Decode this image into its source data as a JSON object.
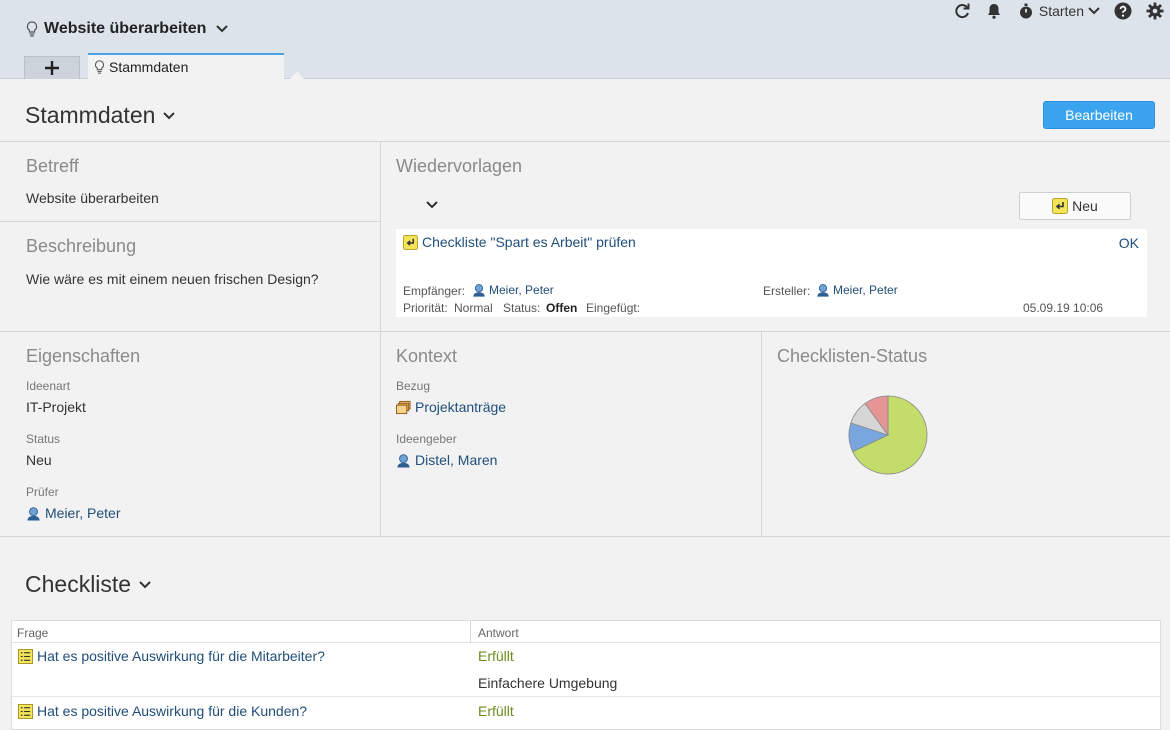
{
  "header": {
    "title": "Website überarbeiten",
    "starten_label": "Starten",
    "tab_label": "Stammdaten"
  },
  "stammdaten": {
    "title": "Stammdaten",
    "edit_label": "Bearbeiten"
  },
  "betreff": {
    "title": "Betreff",
    "value": "Website überarbeiten"
  },
  "beschreibung": {
    "title": "Beschreibung",
    "value": "Wie wäre es mit einem neuen frischen Design?"
  },
  "wiedervorlagen": {
    "title": "Wiedervorlagen",
    "new_label": "Neu",
    "item": {
      "task": "Checkliste \"Spart es Arbeit\" prüfen",
      "action": "OK",
      "recipient_label": "Empfänger:",
      "recipient": "Meier, Peter",
      "creator_label": "Ersteller:",
      "creator": "Meier, Peter",
      "priority_label": "Priorität:",
      "priority": "Normal",
      "status_label": "Status:",
      "status": "Offen",
      "inserted_label": "Eingefügt:",
      "inserted": "05.09.19 10:06"
    }
  },
  "eigenschaften": {
    "title": "Eigenschaften",
    "ideenart_label": "Ideenart",
    "ideenart": "IT-Projekt",
    "status_label": "Status",
    "status": "Neu",
    "pruefer_label": "Prüfer",
    "pruefer": "Meier, Peter"
  },
  "kontext": {
    "title": "Kontext",
    "bezug_label": "Bezug",
    "bezug": "Projektanträge",
    "ideengeber_label": "Ideengeber",
    "ideengeber": "Distel, Maren"
  },
  "checklist_status": {
    "title": "Checklisten-Status"
  },
  "chart_data": {
    "type": "pie",
    "title": "",
    "slices": [
      {
        "value": 0.68,
        "color": "#c4dd6a"
      },
      {
        "value": 0.12,
        "color": "#7aa6e0"
      },
      {
        "value": 0.1,
        "color": "#d6d6d6"
      },
      {
        "value": 0.1,
        "color": "#e69595"
      }
    ]
  },
  "checkliste": {
    "title": "Checkliste",
    "col_question": "Frage",
    "col_answer": "Antwort",
    "rows": [
      {
        "question": "Hat es positive Auswirkung für die Mitarbeiter?",
        "answer": "Erfüllt",
        "note": "Einfachere Umgebung"
      },
      {
        "question": "Hat es positive Auswirkung für die Kunden?",
        "answer": "Erfüllt",
        "note": ""
      }
    ]
  },
  "colors": {
    "accent": "#3aa4ef",
    "link": "#1f4e79",
    "fulfilled": "#6a8b1f"
  }
}
